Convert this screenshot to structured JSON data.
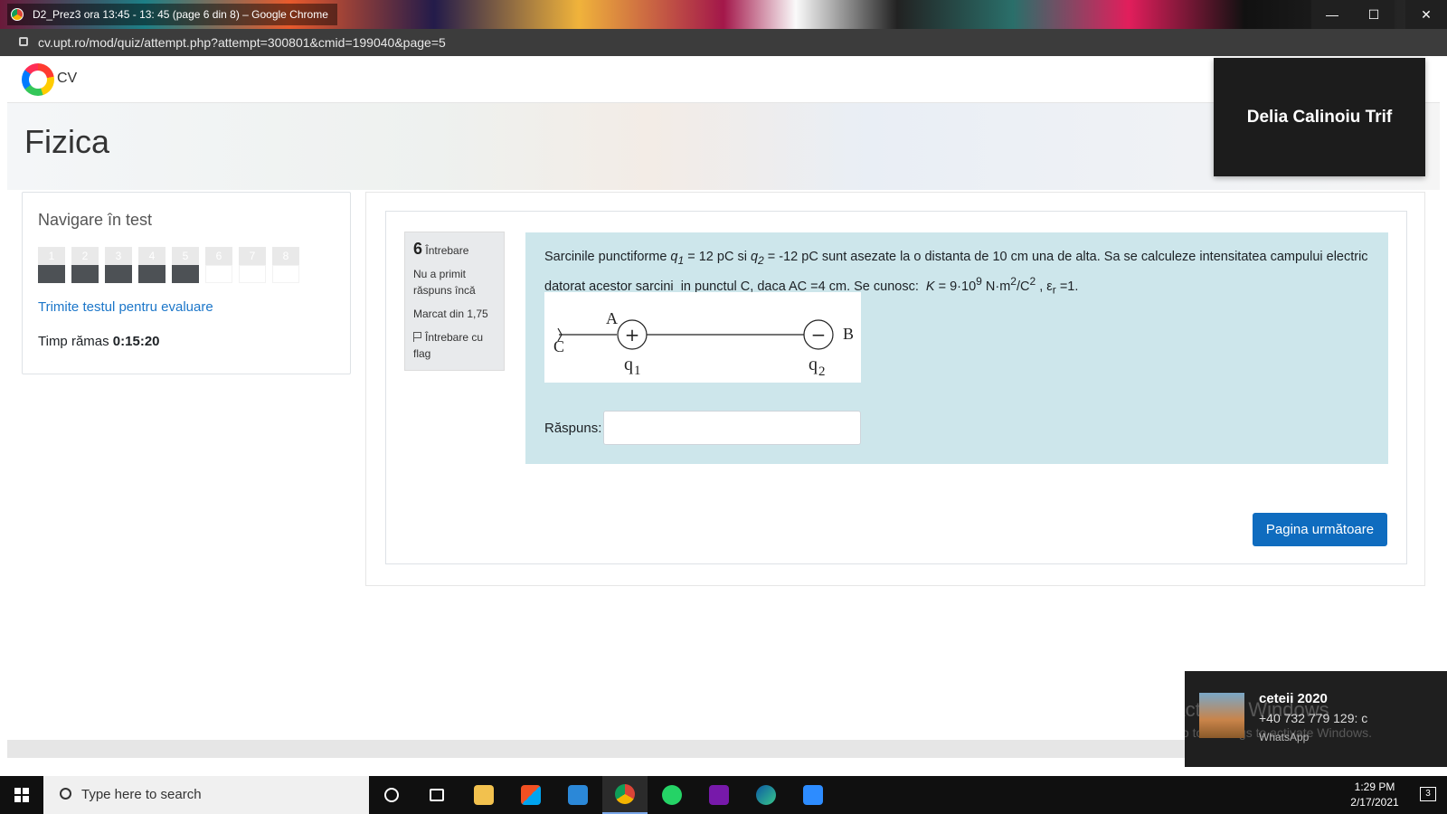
{
  "window": {
    "title": "D2_Prez3 ora 13:45 - 13: 45 (page 6 din 8) – Google Chrome",
    "url": "cv.upt.ro/mod/quiz/attempt.php?attempt=300801&cmid=199040&page=5",
    "minimize": "—",
    "maximize": "☐",
    "close": "✕"
  },
  "site": {
    "logo_text": "CV"
  },
  "page_title": "Fizica",
  "video_overlay": {
    "name": "Delia Calinoiu Trif"
  },
  "quiz_nav": {
    "title": "Navigare în test",
    "questions": [
      {
        "num": "1",
        "answered": true
      },
      {
        "num": "2",
        "answered": true
      },
      {
        "num": "3",
        "answered": true
      },
      {
        "num": "4",
        "answered": true
      },
      {
        "num": "5",
        "answered": true
      },
      {
        "num": "6",
        "answered": false
      },
      {
        "num": "7",
        "answered": false
      },
      {
        "num": "8",
        "answered": false
      }
    ],
    "submit_link": "Trimite testul pentru evaluare",
    "timer_label": "Timp rămas",
    "timer_value": "0:15:20"
  },
  "question": {
    "number": "6",
    "number_label": "Întrebare",
    "status": "Nu a primit răspuns încă",
    "marked": "Marcat din 1,75",
    "flag_label": "Întrebare cu flag",
    "figure": {
      "label_A": "A",
      "label_B": "B",
      "label_C": "C",
      "label_q1": "q",
      "sub_1": "1",
      "label_q2": "q",
      "sub_2": "2",
      "plus": "+",
      "minus": "−"
    },
    "answer_label": "Răspuns:",
    "answer_value": ""
  },
  "buttons": {
    "next": "Pagina următoare"
  },
  "notification": {
    "name": "ceteii 2020",
    "message": "+40 732 779 129: c",
    "app": "WhatsApp",
    "watermark_title": "Activate Windows",
    "watermark_sub": "Go to Settings to activate Windows."
  },
  "taskbar": {
    "search_placeholder": "Type here to search",
    "time": "1:29 PM",
    "date": "2/17/2021",
    "notif_count": "3"
  },
  "colors": {
    "question_bg": "#cde6eb",
    "primary": "#0f6cbf",
    "link": "#1b76c9"
  }
}
